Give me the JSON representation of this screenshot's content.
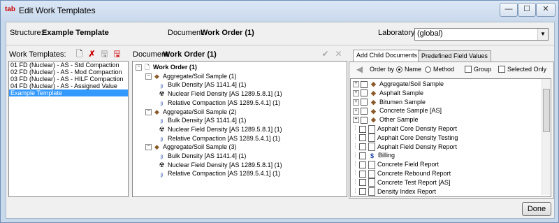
{
  "window": {
    "app_icon": "tab",
    "title": "Edit Work Templates",
    "controls": {
      "minimize": "—",
      "maximize": "☐",
      "close": "✕"
    }
  },
  "header": {
    "structure_label": "Structure:",
    "structure_value": "Example Template",
    "document_label": "Document:",
    "document_value": "Work Order (1)",
    "laboratory_label": "Laboratory:",
    "laboratory_value": "(global)"
  },
  "work_templates": {
    "label": "Work Templates:",
    "items": [
      "01 FD (Nuclear) - AS - Std Compaction",
      "02 FD (Nuclear) - AS - Mod Compaction",
      "03 FD (Nuclear) - AS - HILF Compaction",
      "04 FD (Nuclear) - AS - Assigned Value",
      "Example Template"
    ],
    "selected_index": 4
  },
  "document_panel": {
    "label": "Document:",
    "value": "Work Order (1)",
    "tree": [
      {
        "level": 0,
        "icon": "document-icon",
        "text": "Work Order (1)",
        "bold": true
      },
      {
        "level": 1,
        "icon": "soil-sample-icon",
        "text": "Aggregate/Soil Sample (1)"
      },
      {
        "level": 2,
        "icon": "bulk-icon",
        "text": "Bulk Density [AS 1141.4] (1)"
      },
      {
        "level": 2,
        "icon": "nuclear-icon",
        "text": "Nuclear Field Density [AS 1289.5.8.1] (1)"
      },
      {
        "level": 2,
        "icon": "bulk-icon",
        "text": "Relative Compaction [AS 1289.5.4.1] (1)"
      },
      {
        "level": 1,
        "icon": "soil-sample-icon",
        "text": "Aggregate/Soil Sample (2)"
      },
      {
        "level": 2,
        "icon": "bulk-icon",
        "text": "Bulk Density [AS 1141.4] (1)"
      },
      {
        "level": 2,
        "icon": "nuclear-icon",
        "text": "Nuclear Field Density [AS 1289.5.8.1] (1)"
      },
      {
        "level": 2,
        "icon": "bulk-icon",
        "text": "Relative Compaction [AS 1289.5.4.1] (1)"
      },
      {
        "level": 1,
        "icon": "soil-sample-icon",
        "text": "Aggregate/Soil Sample (3)"
      },
      {
        "level": 2,
        "icon": "bulk-icon",
        "text": "Bulk Density [AS 1141.4] (1)"
      },
      {
        "level": 2,
        "icon": "nuclear-icon",
        "text": "Nuclear Field Density [AS 1289.5.8.1] (1)"
      },
      {
        "level": 2,
        "icon": "bulk-icon",
        "text": "Relative Compaction [AS 1289.5.4.1] (1)"
      }
    ]
  },
  "right_panel": {
    "tabs": [
      "Add Child Documents",
      "Predefined Field Values"
    ],
    "order_by_label": "Order by",
    "order_name": "Name",
    "order_method": "Method",
    "group_label": "Group",
    "selected_only_label": "Selected Only",
    "items": [
      {
        "text": "Aggregate/Soil Sample",
        "expandable": true,
        "icon": "soil-sample-icon"
      },
      {
        "text": "Asphalt Sample",
        "expandable": true,
        "icon": "soil-sample-icon"
      },
      {
        "text": "Bitumen Sample",
        "expandable": true,
        "icon": "soil-sample-icon"
      },
      {
        "text": "Concrete Sample [AS]",
        "expandable": true,
        "icon": "soil-sample-icon"
      },
      {
        "text": "Other Sample",
        "expandable": true,
        "icon": "soil-sample-icon"
      },
      {
        "text": "Asphalt Core Density Report",
        "expandable": false,
        "icon": "report-icon"
      },
      {
        "text": "Asphalt Core Density Testing",
        "expandable": false,
        "icon": "report-icon"
      },
      {
        "text": "Asphalt Field Density Report",
        "expandable": false,
        "icon": "report-icon"
      },
      {
        "text": "Billing",
        "expandable": false,
        "icon": "dollar-icon"
      },
      {
        "text": "Concrete Field Report",
        "expandable": false,
        "icon": "report-icon"
      },
      {
        "text": "Concrete Rebound Report",
        "expandable": false,
        "icon": "report-icon"
      },
      {
        "text": "Concrete Test Report [AS]",
        "expandable": false,
        "icon": "report-icon"
      },
      {
        "text": "Density Index Report",
        "expandable": false,
        "icon": "report-icon"
      }
    ]
  },
  "footer": {
    "done_label": "Done"
  },
  "colors": {
    "selection": "#3399ff",
    "title_bg": "#dbe7f5"
  }
}
